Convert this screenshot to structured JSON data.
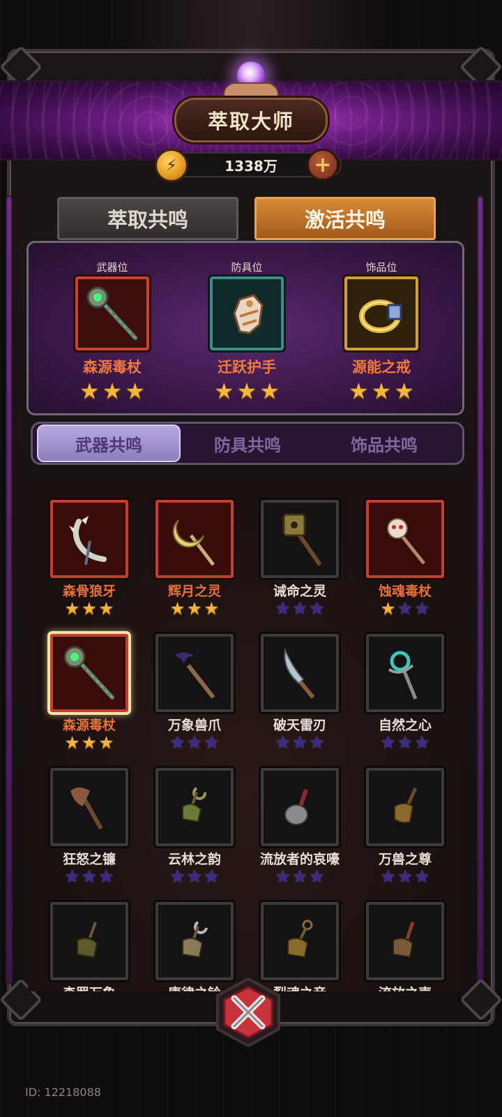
{
  "header": {
    "title": "萃取大师"
  },
  "currency": {
    "amount": "1338万",
    "coin_icon": "lightning-coin-icon",
    "add_icon": "plus-icon"
  },
  "main_tabs": [
    {
      "label": "萃取共鸣",
      "active": false
    },
    {
      "label": "激活共鸣",
      "active": true
    }
  ],
  "slots": [
    {
      "label": "武器位",
      "item": "森源毒杖",
      "stars": 3,
      "frame": "red",
      "icon": "staff-icon"
    },
    {
      "label": "防具位",
      "item": "迁跃护手",
      "stars": 3,
      "frame": "teal",
      "icon": "gauntlet-icon"
    },
    {
      "label": "饰品位",
      "item": "源能之戒",
      "stars": 3,
      "frame": "gold",
      "icon": "ring-icon"
    }
  ],
  "sub_tabs": [
    {
      "label": "武器共鸣",
      "active": true
    },
    {
      "label": "防具共鸣",
      "active": false
    },
    {
      "label": "饰品共鸣",
      "active": false
    }
  ],
  "items": [
    {
      "name": "森骨狼牙",
      "stars": 3,
      "rarity": "red",
      "icon": "bone-blade-icon"
    },
    {
      "name": "辉月之灵",
      "stars": 3,
      "rarity": "red",
      "icon": "moon-staff-icon"
    },
    {
      "name": "诫命之灵",
      "stars": 0,
      "rarity": "dark",
      "icon": "totem-staff-icon"
    },
    {
      "name": "蚀魂毒杖",
      "stars": 1,
      "rarity": "red",
      "icon": "skull-staff-icon"
    },
    {
      "name": "森源毒杖",
      "stars": 3,
      "rarity": "red",
      "icon": "staff-icon",
      "selected": true
    },
    {
      "name": "万象兽爪",
      "stars": 0,
      "rarity": "dark",
      "icon": "claw-staff-icon"
    },
    {
      "name": "破天雷刃",
      "stars": 0,
      "rarity": "dark",
      "icon": "lightning-blade-icon"
    },
    {
      "name": "自然之心",
      "stars": 0,
      "rarity": "dark",
      "icon": "nature-staff-icon"
    },
    {
      "name": "狂怒之镰",
      "stars": 0,
      "rarity": "dark",
      "icon": "axe-icon"
    },
    {
      "name": "云林之韵",
      "stars": 0,
      "rarity": "dark",
      "icon": "bell-icon"
    },
    {
      "name": "流放者的哀嚎",
      "stars": 0,
      "rarity": "dark",
      "icon": "mace-icon"
    },
    {
      "name": "万兽之尊",
      "stars": 0,
      "rarity": "dark",
      "icon": "horn-icon"
    },
    {
      "name": "森罗万象",
      "stars": 0,
      "rarity": "dark",
      "icon": "bell-icon"
    },
    {
      "name": "康律之铃",
      "stars": 0,
      "rarity": "dark",
      "icon": "bell-icon"
    },
    {
      "name": "裂魂之音",
      "stars": 0,
      "rarity": "dark",
      "icon": "bell-icon"
    },
    {
      "name": "流放之声",
      "stars": 0,
      "rarity": "dark",
      "icon": "bell-icon"
    }
  ],
  "footer": {
    "close_icon": "close-x-icon",
    "user_id": "ID: 12218088"
  },
  "colors": {
    "accent_purple": "#6f1e86",
    "rarity_red": "#c23e30",
    "star_gold": "#f5b53d",
    "star_empty": "#3c2b86",
    "item_name_red": "#e9703a"
  }
}
